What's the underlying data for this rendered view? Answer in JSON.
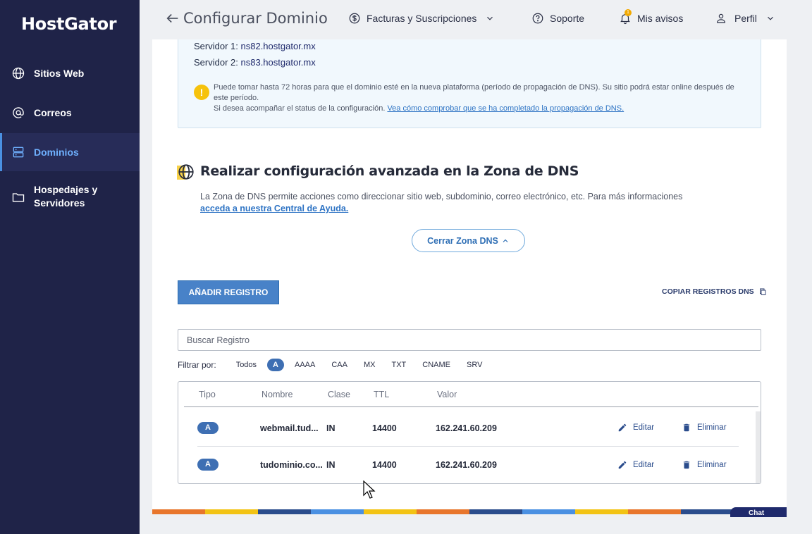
{
  "brand": {
    "logo": "HostGator"
  },
  "sidebar": {
    "items": [
      {
        "label": "Sitios Web",
        "icon": "globe-icon"
      },
      {
        "label": "Correos",
        "icon": "at-icon"
      },
      {
        "label": "Dominios",
        "icon": "server-icon",
        "active": true
      },
      {
        "label": "Hospedajes y Servidores",
        "icon": "folder-icon"
      }
    ]
  },
  "header": {
    "title": "Configurar Dominio",
    "billing": "Facturas y Suscripciones",
    "support": "Soporte",
    "notices": "Mis avisos",
    "notices_count": "1",
    "profile": "Perfil"
  },
  "info": {
    "server1_label": "Servidor 1:",
    "server1_value": "ns82.hostgator.mx",
    "server2_label": "Servidor 2:",
    "server2_value": "ns83.hostgator.mx",
    "warning_line1": "Puede tomar hasta 72 horas para que el dominio esté en la nueva plataforma (período de propagación de DNS). Su sitio podrá estar online después de este período.",
    "warning_line2": "Si desea acompañar el status de la configuración.",
    "warning_link": "Vea cómo comprobar que se ha completado la propagación de DNS."
  },
  "dns_zone": {
    "title": "Realizar configuración avanzada en la Zona de DNS",
    "description": "La Zona de DNS permite acciones como direccionar sitio web, subdominio, correo electrónico, etc. Para más informaciones",
    "help_link": "acceda a nuestra Central de Ayuda.",
    "close_button": "Cerrar Zona DNS"
  },
  "toolbar": {
    "add_label": "AÑADIR REGISTRO",
    "copy_label": "COPIAR REGISTROS DNS"
  },
  "search": {
    "placeholder": "Buscar Registro"
  },
  "filter": {
    "label": "Filtrar por:",
    "options": [
      "Todos",
      "A",
      "AAAA",
      "CAA",
      "MX",
      "TXT",
      "CNAME",
      "SRV"
    ],
    "selected": "A"
  },
  "table": {
    "headers": [
      "Tipo",
      "Nombre",
      "Clase",
      "TTL",
      "Valor"
    ],
    "rows": [
      {
        "type": "A",
        "name": "webmail.tud...",
        "class": "IN",
        "ttl": "14400",
        "value": "162.241.60.209"
      },
      {
        "type": "A",
        "name": "tudominio.co...",
        "class": "IN",
        "ttl": "14400",
        "value": "162.241.60.209"
      }
    ],
    "edit_label": "Editar",
    "delete_label": "Eliminar"
  },
  "chat": {
    "label": "Chat"
  },
  "colors": {
    "sidebar_bg": "#1f2348",
    "accent": "#4882c8",
    "active_nav": "#6fb1ff",
    "footer_stripes": [
      "#e8762c",
      "#f2c314",
      "#2a4c8c",
      "#4a90e2",
      "#f2c314",
      "#e8762c",
      "#2a4c8c",
      "#4a90e2",
      "#f2c314",
      "#e8762c",
      "#2a4c8c",
      "#f2c314"
    ]
  }
}
